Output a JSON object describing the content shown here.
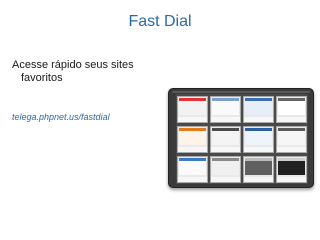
{
  "slide": {
    "title": "Fast Dial",
    "bullet": "Acesse rápido seus sites favoritos",
    "link": "telega.phpnet.us/fastdial"
  },
  "screenshot": {
    "tiles": [
      {
        "label": "",
        "color": "#f2f2f2",
        "accent": "#d33"
      },
      {
        "label": "",
        "color": "#fafafa",
        "accent": "#7aa0d0"
      },
      {
        "label": "",
        "color": "#e8eef8",
        "accent": "#3a6fb3"
      },
      {
        "label": "",
        "color": "#ffffff",
        "accent": "#666"
      },
      {
        "label": "",
        "color": "#fdf3e8",
        "accent": "#e07a1a"
      },
      {
        "label": "",
        "color": "#f4f4f4",
        "accent": "#4a4a4a"
      },
      {
        "label": "",
        "color": "#eef4fb",
        "accent": "#2d5fa5"
      },
      {
        "label": "",
        "color": "#f6f6f6",
        "accent": "#5a5a5a"
      },
      {
        "label": "",
        "color": "#fbfbfb",
        "accent": "#3c79c8"
      },
      {
        "label": "",
        "color": "#f0f0f0",
        "accent": "#888"
      },
      {
        "label": "",
        "color": "#606060",
        "accent": "#bbb"
      },
      {
        "label": "",
        "color": "#202020",
        "accent": "#ccc"
      }
    ]
  }
}
